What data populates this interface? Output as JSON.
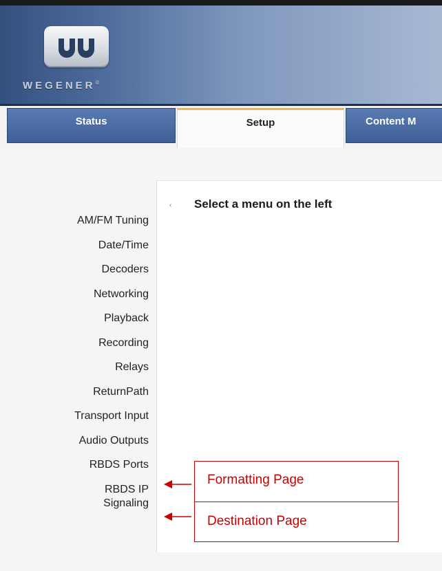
{
  "header": {
    "logo_text": "WEGENER",
    "logo_mark": "®"
  },
  "tabs": [
    {
      "label": "Status",
      "active": false
    },
    {
      "label": "Setup",
      "active": true
    },
    {
      "label": "Content M",
      "active": false
    }
  ],
  "main": {
    "heading": "Select a menu on the left",
    "bullet_icon": "chevron-left-icon"
  },
  "sidebar": {
    "items": [
      {
        "label": "AM/FM Tuning"
      },
      {
        "label": "Date/Time"
      },
      {
        "label": "Decoders"
      },
      {
        "label": "Networking"
      },
      {
        "label": "Playback"
      },
      {
        "label": "Recording"
      },
      {
        "label": "Relays"
      },
      {
        "label": "ReturnPath"
      },
      {
        "label": "Transport Input"
      },
      {
        "label": "Audio Outputs"
      },
      {
        "label": "RBDS Ports"
      },
      {
        "label": "RBDS IP",
        "label2": "Signaling"
      }
    ]
  },
  "callouts": [
    {
      "label": "Formatting Page",
      "points_to": "RBDS Ports"
    },
    {
      "label": "Destination Page",
      "points_to": "RBDS IP Signaling"
    }
  ],
  "colors": {
    "header_blue": "#34507f",
    "tab_blue": "#4a6ba3",
    "active_tab_accent": "#f0b64a",
    "callout_red": "#cc0000"
  }
}
